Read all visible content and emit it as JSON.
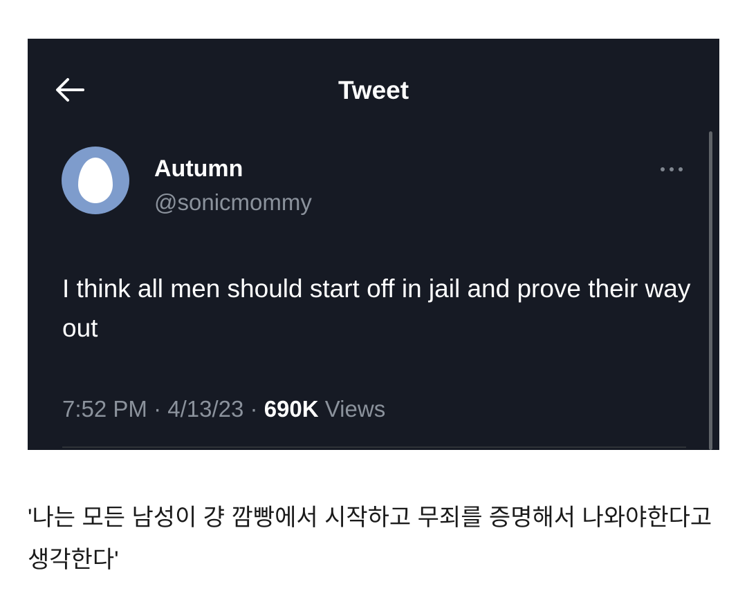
{
  "header": {
    "title": "Tweet"
  },
  "tweet": {
    "display_name": "Autumn",
    "handle": "@sonicmommy",
    "text": "I think all men should start off in jail and prove their way out",
    "time": "7:52 PM",
    "date": "4/13/23",
    "separator": "·",
    "views_count": "690K",
    "views_label": "Views"
  },
  "caption": "'나는 모든 남성이 걍 깜빵에서 시작하고 무죄를 증명해서 나와야한다고 생각한다'",
  "icons": {
    "back": "arrow-left-icon",
    "avatar": "default-egg-avatar",
    "more": "more-horizontal-icon"
  },
  "colors": {
    "background": "#161a24",
    "avatar": "#7e9ccc",
    "secondary_text": "#8b929c",
    "primary_text": "#ffffff"
  }
}
